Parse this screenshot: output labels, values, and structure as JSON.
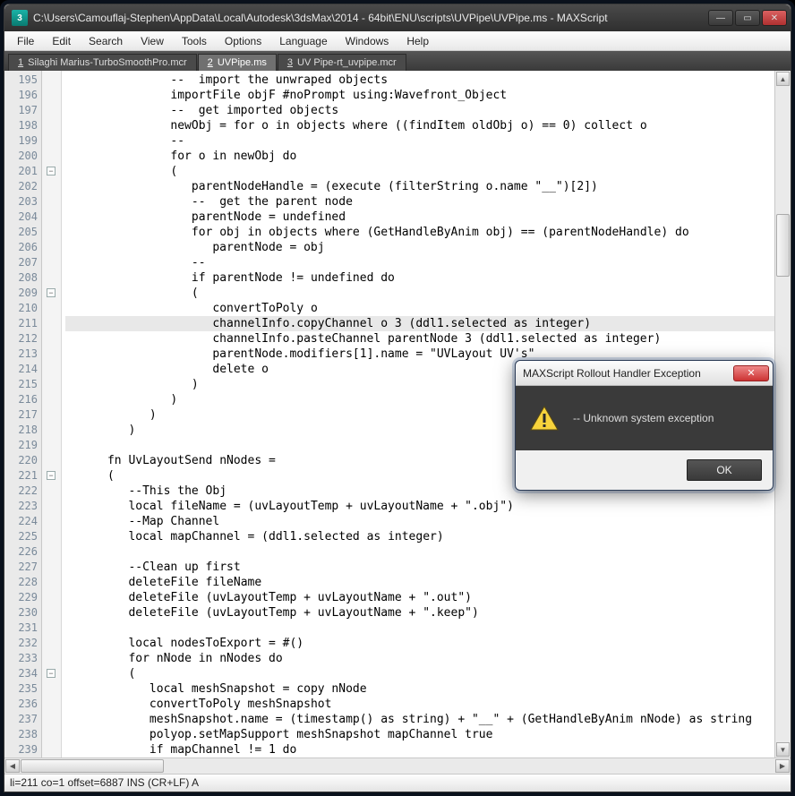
{
  "window": {
    "title": "C:\\Users\\Camouflaj-Stephen\\AppData\\Local\\Autodesk\\3dsMax\\2014 - 64bit\\ENU\\scripts\\UVPipe\\UVPipe.ms - MAXScript",
    "app_icon_text": "3"
  },
  "menu": [
    "File",
    "Edit",
    "Search",
    "View",
    "Tools",
    "Options",
    "Language",
    "Windows",
    "Help"
  ],
  "tabs": [
    {
      "num": "1",
      "label": "Silaghi Marius-TurboSmoothPro.mcr",
      "active": false
    },
    {
      "num": "2",
      "label": "UVPipe.ms",
      "active": true
    },
    {
      "num": "3",
      "label": "UV Pipe-rt_uvpipe.mcr",
      "active": false
    }
  ],
  "gutter_start": 195,
  "gutter_end": 239,
  "fold_boxes": [
    {
      "line": 201,
      "sym": "−"
    },
    {
      "line": 209,
      "sym": "−"
    },
    {
      "line": 221,
      "sym": "−"
    },
    {
      "line": 234,
      "sym": "−"
    }
  ],
  "highlight_line": 211,
  "code_lines": [
    "               <cm>--  import the unwraped objects</cm>",
    "               <aq>importFile</aq> objF <aq>#noPrompt</aq> <kw2>using</kw2>:Wavefront_Object",
    "               <cm>--  get imported objects</cm>",
    "               newObj = <kw>for</kw> o <kw>in</kw> <it>objects</it> <kw>where</kw> <kw>((</kw><aq>findItem</aq> oldObj o<kw>)</kw> == <num>0</num><kw>)</kw> <kw>collect</kw> o",
    "               <cm>--</cm>",
    "               <kw>for</kw> o <kw>in</kw> newObj <kw>do</kw>",
    "               <kw>(</kw>",
    "                  parentNodeHandle = <kw>(</kw><aq>execute</aq> <kw>(</kw><aq>filterString</aq> o.name <str>\"__\"</str><kw>)[</kw><num>2</num><kw>])</kw>",
    "                  <cm>--  get the parent node</cm>",
    "                  parentNode = <ud>undefined</ud>",
    "                  <kw>for</kw> obj <kw>in</kw> <it>objects</it> <kw>where</kw> <kw>(</kw><aq>GetHandleByAnim</aq> obj<kw>)</kw> == <kw>(</kw>parentNodeHandle<kw>)</kw> <kw>do</kw>",
    "                     parentNode = obj",
    "                  <cm>--</cm>",
    "                  <kw>if</kw> parentNode != <ud>undefined</ud> <kw>do</kw>",
    "                  <kw>(</kw>",
    "                     <aq>convertToPoly</aq> o",
    "                     channelInfo.copyChannel o <num>3</num> <kw>(</kw>ddl1.selected <kw>as</kw> <kw2>integer</kw2><kw>)</kw>",
    "                     channelInfo.pasteChannel parentNode <num>3</num> <kw>(</kw>ddl1.selected <kw>as</kw> <kw2>integer</kw2><kw>)</kw>",
    "                     parentNode.modifiers<kw>[</kw><num>1</num><kw>]</kw>.name = <str>\"UVLayout UV's\"</str>",
    "                     <aq>delete</aq> o",
    "                  <kw>)</kw>",
    "               <kw>)</kw>",
    "            <kw>)</kw>",
    "         <kw>)</kw>",
    "",
    "      <kw>fn</kw> UvLayoutSend nNodes =",
    "      <kw>(</kw>",
    "         <cm>--This the Obj</cm>",
    "         <kw>local</kw> fileName = <kw>(</kw>uvLayoutTemp + uvLayoutName + <str>\".obj\"</str><kw>)</kw>",
    "         <cm>--Map Channel</cm>",
    "         <kw>local</kw> mapChannel = <kw>(</kw>ddl1.selected <kw>as</kw> <kw2>integer</kw2><kw>)</kw>",
    "",
    "         <cm>--Clean up first</cm>",
    "         <aq>deleteFile</aq> fileName",
    "         <aq>deleteFile</aq> <kw>(</kw>uvLayoutTemp + uvLayoutName + <str>\".out\"</str><kw>)</kw>",
    "         <aq>deleteFile</aq> <kw>(</kw>uvLayoutTemp + uvLayoutName + <str>\".keep\"</str><kw>)</kw>",
    "",
    "         <kw>local</kw> nodesToExport = <aq>#</aq><kw>()</kw>",
    "         <kw>for</kw> nNode <kw>in</kw> nNodes <kw>do</kw>",
    "         <kw>(</kw>",
    "            <kw>local</kw> meshSnapshot = <aq>copy</aq> nNode",
    "            <aq>convertToPoly</aq> meshSnapshot",
    "            meshSnapshot.name = <kw>(</kw><aq>timestamp</aq><kw>()</kw> <kw>as</kw> <kw2>string</kw2><kw>)</kw> + <str>\"__\"</str> + <kw>(</kw><aq>GetHandleByAnim</aq> nNode<kw>)</kw> <kw>as</kw> <kw2>string</kw2>",
    "            polyop.setMapSupport meshSnapshot mapChannel <it>true</it>",
    "            <kw>if</kw> mapChannel != <num>1</num> <kw>do</kw>"
  ],
  "statusbar": "li=211 co=1 offset=6887 INS (CR+LF) A",
  "dialog": {
    "title": "MAXScript Rollout Handler Exception",
    "message": "-- Unknown system exception",
    "ok": "OK",
    "close_glyph": "✕"
  },
  "glyphs": {
    "min": "—",
    "max": "▭",
    "close": "✕",
    "left": "◀",
    "right": "▶",
    "up": "▲",
    "down": "▼"
  }
}
